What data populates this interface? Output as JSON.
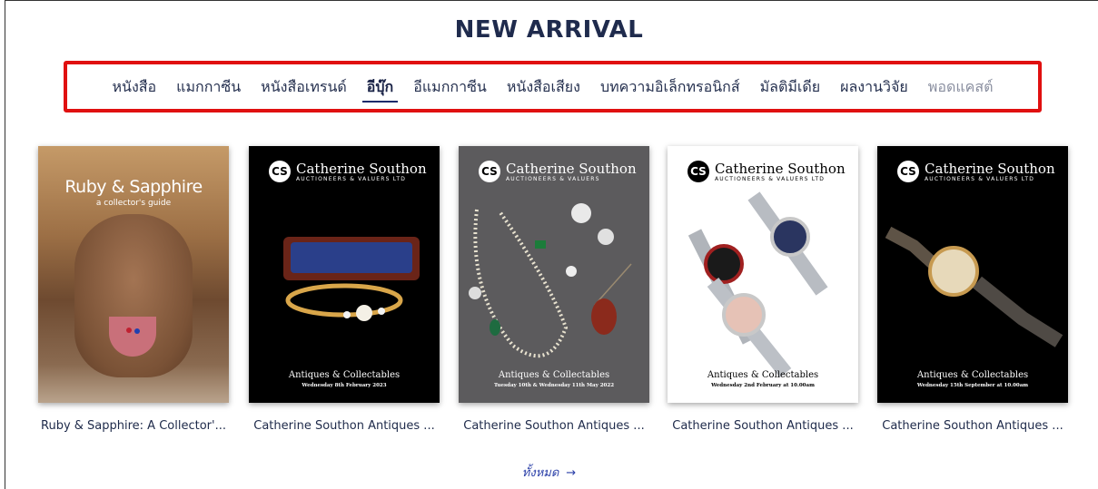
{
  "section": {
    "title": "NEW ARRIVAL"
  },
  "tabs": [
    {
      "label": "หนังสือ",
      "state": "normal"
    },
    {
      "label": "แมกกาซีน",
      "state": "normal"
    },
    {
      "label": "หนังสือเทรนด์",
      "state": "normal"
    },
    {
      "label": "อีบุ๊ก",
      "state": "active"
    },
    {
      "label": "อีแมกกาซีน",
      "state": "normal"
    },
    {
      "label": "หนังสือเสียง",
      "state": "normal"
    },
    {
      "label": "บทความอิเล็กทรอนิกส์",
      "state": "normal"
    },
    {
      "label": "มัลติมีเดีย",
      "state": "normal"
    },
    {
      "label": "ผลงานวิจัย",
      "state": "normal"
    },
    {
      "label": "พอดแคสต์",
      "state": "muted"
    }
  ],
  "items": [
    {
      "title": "Ruby & Sapphire: A Collector'...",
      "cover": {
        "style": "photo",
        "heading": "Ruby & Sapphire",
        "subheading": "a collector's guide"
      }
    },
    {
      "title": "Catherine Southon Antiques ...",
      "cover": {
        "style": "black",
        "brand": "Catherine Southon",
        "brand_sub": "AUCTIONEERS & VALUERS LTD",
        "line1": "Antiques & Collectables",
        "line2": "Wednesday 8th February 2023"
      }
    },
    {
      "title": "Catherine Southon Antiques ...",
      "cover": {
        "style": "grey",
        "brand": "Catherine Southon",
        "brand_sub": "AUCTIONEERS & VALUERS",
        "line1": "Antiques & Collectables",
        "line2": "Tuesday 10th & Wednesday 11th May 2022"
      }
    },
    {
      "title": "Catherine Southon Antiques ...",
      "cover": {
        "style": "white",
        "brand": "Catherine Southon",
        "brand_sub": "AUCTIONEERS & VALUERS LTD",
        "line1": "Antiques & Collectables",
        "line2": "Wednesday 2nd February at 10.00am"
      }
    },
    {
      "title": "Catherine Southon Antiques ...",
      "cover": {
        "style": "black",
        "brand": "Catherine Southon",
        "brand_sub": "AUCTIONEERS & VALUERS LTD",
        "line1": "Antiques & Collectables",
        "line2": "Wednesday 15th September at 10.00am"
      }
    }
  ],
  "more_link": {
    "label": "ทั้งหมด",
    "icon": "arrow-right-icon",
    "glyph": "→"
  },
  "colors": {
    "tab_border": "#e01010",
    "title": "#1f2b4d",
    "link": "#2a3fa8",
    "active_underline": "#1a2a6b"
  }
}
